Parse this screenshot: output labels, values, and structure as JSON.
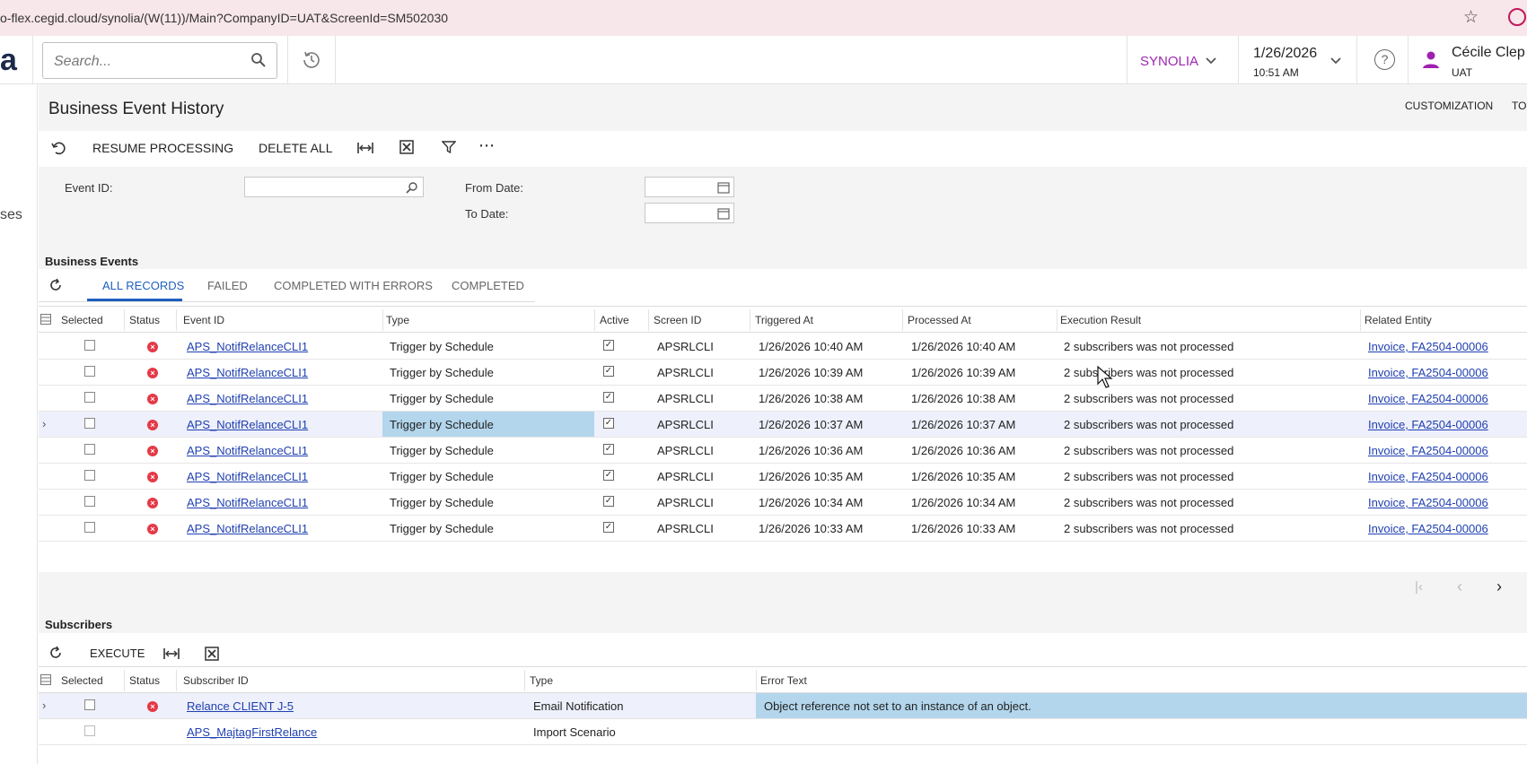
{
  "browser": {
    "url": "o-flex.cegid.cloud/synolia/(W(11))/Main?CompanyID=UAT&ScreenId=SM502030",
    "bookmark_icon": "star-icon",
    "profile_icon": "profile-icon"
  },
  "header": {
    "logo_text": "a",
    "search_placeholder": "Search...",
    "tenant": "SYNOLIA",
    "date": "1/26/2026",
    "time": "10:51 AM",
    "help": "?",
    "user_name": "Cécile Clep",
    "user_company": "UAT"
  },
  "leftnav": {
    "partial_label": "ses"
  },
  "page": {
    "title": "Business Event History",
    "actions": [
      "CUSTOMIZATION",
      "TO"
    ]
  },
  "toolbar": {
    "resume": "RESUME PROCESSING",
    "delete_all": "DELETE ALL"
  },
  "filters": {
    "event_id_label": "Event ID:",
    "event_id_value": "",
    "from_date_label": "From Date:",
    "from_date_value": "",
    "to_date_label": "To Date:",
    "to_date_value": ""
  },
  "events": {
    "section_title": "Business Events",
    "tabs": [
      "ALL RECORDS",
      "FAILED",
      "COMPLETED WITH ERRORS",
      "COMPLETED"
    ],
    "active_tab": "ALL RECORDS",
    "columns": [
      "Selected",
      "Status",
      "Event ID",
      "Type",
      "Active",
      "Screen ID",
      "Triggered At",
      "Processed At",
      "Execution Result",
      "Related Entity"
    ],
    "rows": [
      {
        "event_id": "APS_NotifRelanceCLI1",
        "type": "Trigger by Schedule",
        "active": true,
        "screen_id": "APSRLCLI",
        "triggered": "1/26/2026 10:40 AM",
        "processed": "1/26/2026 10:40 AM",
        "result": "2 subscribers was not processed",
        "entity": "Invoice, FA2504-00006"
      },
      {
        "event_id": "APS_NotifRelanceCLI1",
        "type": "Trigger by Schedule",
        "active": true,
        "screen_id": "APSRLCLI",
        "triggered": "1/26/2026 10:39 AM",
        "processed": "1/26/2026 10:39 AM",
        "result": "2 subscribers was not processed",
        "entity": "Invoice, FA2504-00006"
      },
      {
        "event_id": "APS_NotifRelanceCLI1",
        "type": "Trigger by Schedule",
        "active": true,
        "screen_id": "APSRLCLI",
        "triggered": "1/26/2026 10:38 AM",
        "processed": "1/26/2026 10:38 AM",
        "result": "2 subscribers was not processed",
        "entity": "Invoice, FA2504-00006"
      },
      {
        "event_id": "APS_NotifRelanceCLI1",
        "type": "Trigger by Schedule",
        "active": true,
        "screen_id": "APSRLCLI",
        "triggered": "1/26/2026 10:37 AM",
        "processed": "1/26/2026 10:37 AM",
        "result": "2 subscribers was not processed",
        "entity": "Invoice, FA2504-00006"
      },
      {
        "event_id": "APS_NotifRelanceCLI1",
        "type": "Trigger by Schedule",
        "active": true,
        "screen_id": "APSRLCLI",
        "triggered": "1/26/2026 10:36 AM",
        "processed": "1/26/2026 10:36 AM",
        "result": "2 subscribers was not processed",
        "entity": "Invoice, FA2504-00006"
      },
      {
        "event_id": "APS_NotifRelanceCLI1",
        "type": "Trigger by Schedule",
        "active": true,
        "screen_id": "APSRLCLI",
        "triggered": "1/26/2026 10:35 AM",
        "processed": "1/26/2026 10:35 AM",
        "result": "2 subscribers was not processed",
        "entity": "Invoice, FA2504-00006"
      },
      {
        "event_id": "APS_NotifRelanceCLI1",
        "type": "Trigger by Schedule",
        "active": true,
        "screen_id": "APSRLCLI",
        "triggered": "1/26/2026 10:34 AM",
        "processed": "1/26/2026 10:34 AM",
        "result": "2 subscribers was not processed",
        "entity": "Invoice, FA2504-00006"
      },
      {
        "event_id": "APS_NotifRelanceCLI1",
        "type": "Trigger by Schedule",
        "active": true,
        "screen_id": "APSRLCLI",
        "triggered": "1/26/2026 10:33 AM",
        "processed": "1/26/2026 10:33 AM",
        "result": "2 subscribers was not processed",
        "entity": "Invoice, FA2504-00006"
      }
    ]
  },
  "subscribers": {
    "section_title": "Subscribers",
    "execute": "EXECUTE",
    "columns": [
      "Selected",
      "Status",
      "Subscriber ID",
      "Type",
      "Error Text"
    ],
    "rows": [
      {
        "subscriber_id": "Relance CLIENT J-5",
        "type": "Email Notification",
        "error": "Object reference not set to an instance of an object."
      },
      {
        "subscriber_id": "APS_MajtagFirstRelance",
        "type": "Import Scenario",
        "error": ""
      }
    ]
  },
  "colors": {
    "accent": "#1f5fbf",
    "tenant": "#9c27b0",
    "error": "#e53946",
    "highlight": "#b3d6ec"
  }
}
